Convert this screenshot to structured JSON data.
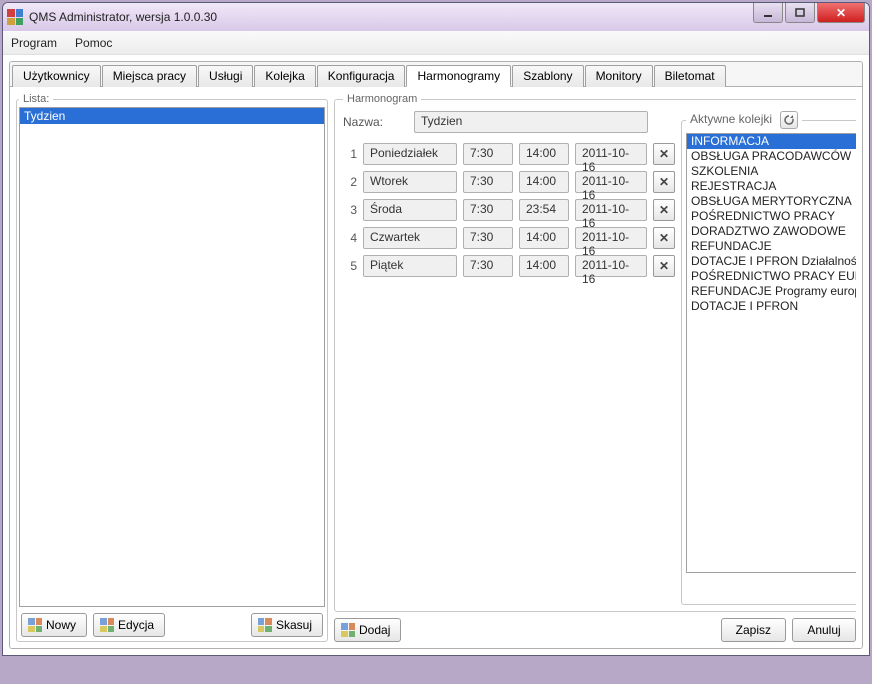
{
  "window": {
    "title": "QMS Administrator, wersja 1.0.0.30"
  },
  "menu": {
    "program": "Program",
    "pomoc": "Pomoc"
  },
  "tabs": {
    "items": [
      {
        "id": "uzytkownicy",
        "label": "Użytkownicy"
      },
      {
        "id": "miejsca",
        "label": "Miejsca pracy"
      },
      {
        "id": "uslugi",
        "label": "Usługi"
      },
      {
        "id": "kolejka",
        "label": "Kolejka"
      },
      {
        "id": "konfiguracja",
        "label": "Konfiguracja"
      },
      {
        "id": "harmonogramy",
        "label": "Harmonogramy"
      },
      {
        "id": "szablony",
        "label": "Szablony"
      },
      {
        "id": "monitory",
        "label": "Monitory"
      },
      {
        "id": "biletomat",
        "label": "Biletomat"
      }
    ],
    "active": "harmonogramy"
  },
  "lista": {
    "legend": "Lista:",
    "items": [
      "Tydzien"
    ],
    "selected": 0,
    "nowy": "Nowy",
    "edycja": "Edycja",
    "skasuj": "Skasuj"
  },
  "harm": {
    "legend": "Harmonogram",
    "nazwa_label": "Nazwa:",
    "nazwa_value": "Tydzien",
    "rows": [
      {
        "n": "1",
        "day": "Poniedziałek",
        "from": "7:30",
        "to": "14:00",
        "date": "2011-10-16"
      },
      {
        "n": "2",
        "day": "Wtorek",
        "from": "7:30",
        "to": "14:00",
        "date": "2011-10-16"
      },
      {
        "n": "3",
        "day": "Środa",
        "from": "7:30",
        "to": "23:54",
        "date": "2011-10-16"
      },
      {
        "n": "4",
        "day": "Czwartek",
        "from": "7:30",
        "to": "14:00",
        "date": "2011-10-16"
      },
      {
        "n": "5",
        "day": "Piątek",
        "from": "7:30",
        "to": "14:00",
        "date": "2011-10-16"
      }
    ],
    "dodaj": "Dodaj",
    "zapisz": "Zapisz",
    "anuluj": "Anuluj"
  },
  "queues": {
    "legend": "Aktywne kolejki",
    "items": [
      "INFORMACJA",
      "OBSŁUGA PRACODAWCÓW",
      "SZKOLENIA",
      "REJESTRACJA",
      "OBSŁUGA MERYTORYCZNA",
      "POŚREDNICTWO PRACY",
      "DORADZTWO ZAWODOWE",
      "REFUNDACJE",
      "DOTACJE I PFRON Działalność",
      "POŚREDNICTWO PRACY EURES",
      "REFUNDACJE Programy europejskie",
      "DOTACJE I PFRON"
    ],
    "selected": 0
  }
}
